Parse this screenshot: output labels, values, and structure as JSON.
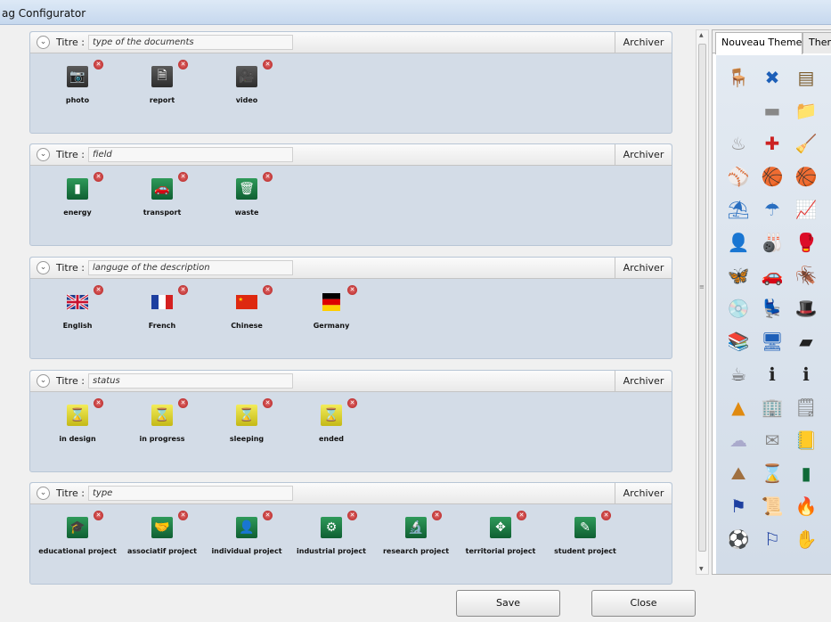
{
  "window": {
    "title": "ag Configurator"
  },
  "groups": [
    {
      "title_label": "Titre :",
      "title_value": "type of the documents",
      "archive_label": "Archiver",
      "items": [
        {
          "label": "photo",
          "icon": "camera-icon",
          "glyph": "📷",
          "style": "dark"
        },
        {
          "label": "report",
          "icon": "document-icon",
          "glyph": "🗎",
          "style": "dark"
        },
        {
          "label": "video",
          "icon": "video-camera-icon",
          "glyph": "🎥",
          "style": "dark"
        }
      ]
    },
    {
      "title_label": "Titre :",
      "title_value": "field",
      "archive_label": "Archiver",
      "items": [
        {
          "label": "energy",
          "icon": "battery-icon",
          "glyph": "▮",
          "style": "green"
        },
        {
          "label": "transport",
          "icon": "car-icon",
          "glyph": "🚗",
          "style": "green"
        },
        {
          "label": "waste",
          "icon": "trash-icon",
          "glyph": "🗑",
          "style": "green"
        }
      ]
    },
    {
      "title_label": "Titre :",
      "title_value": "languge of the description",
      "archive_label": "Archiver",
      "items": [
        {
          "label": "English",
          "icon": "uk-flag-icon",
          "glyph": "",
          "style": "flag-uk"
        },
        {
          "label": "French",
          "icon": "french-flag-icon",
          "glyph": "",
          "style": "flag-fr"
        },
        {
          "label": "Chinese",
          "icon": "chinese-flag-icon",
          "glyph": "",
          "style": "flag-cn"
        },
        {
          "label": "Germany",
          "icon": "german-flag-icon",
          "glyph": "",
          "style": "flag-de"
        }
      ]
    },
    {
      "title_label": "Titre :",
      "title_value": "status",
      "archive_label": "Archiver",
      "items": [
        {
          "label": "in design",
          "icon": "hourglass-icon",
          "glyph": "⌛",
          "style": "yellow"
        },
        {
          "label": "in progress",
          "icon": "hourglass-icon",
          "glyph": "⌛",
          "style": "yellow"
        },
        {
          "label": "sleeping",
          "icon": "hourglass-icon",
          "glyph": "⌛",
          "style": "yellow"
        },
        {
          "label": "ended",
          "icon": "hourglass-icon",
          "glyph": "⌛",
          "style": "yellow"
        }
      ]
    },
    {
      "title_label": "Titre :",
      "title_value": "type",
      "archive_label": "Archiver",
      "items": [
        {
          "label": "educational project",
          "icon": "graduation-cap-icon",
          "glyph": "🎓",
          "style": "green"
        },
        {
          "label": "associatif project",
          "icon": "handshake-icon",
          "glyph": "🤝",
          "style": "green"
        },
        {
          "label": "individual project",
          "icon": "user-icon",
          "glyph": "👤",
          "style": "green"
        },
        {
          "label": "industrial project",
          "icon": "gears-icon",
          "glyph": "⚙",
          "style": "green"
        },
        {
          "label": "research project",
          "icon": "microscope-icon",
          "glyph": "🔬",
          "style": "green"
        },
        {
          "label": "territorial project",
          "icon": "compass-icon",
          "glyph": "✥",
          "style": "green"
        },
        {
          "label": "student project",
          "icon": "notepad-icon",
          "glyph": "✎",
          "style": "green"
        }
      ]
    }
  ],
  "delete_glyph": "✕",
  "theme_panel": {
    "tabs": [
      "Nouveau Theme",
      "Them"
    ],
    "icons": [
      {
        "name": "chair-icon",
        "glyph": "🪑",
        "color": "#d42020"
      },
      {
        "name": "cross-icon",
        "glyph": "✖",
        "color": "#1d5fb8"
      },
      {
        "name": "abacus-icon",
        "glyph": "▤",
        "color": "#7a5a2a"
      },
      {
        "name": "apple-icon",
        "glyph": "",
        "color": "#3a8fd6"
      },
      {
        "name": "harddrive-icon",
        "glyph": "▬",
        "color": "#888"
      },
      {
        "name": "folder-icon",
        "glyph": "📁",
        "color": "#5aa0d0"
      },
      {
        "name": "chef-hat-icon",
        "glyph": "♨",
        "color": "#999"
      },
      {
        "name": "first-aid-icon",
        "glyph": "✚",
        "color": "#c22"
      },
      {
        "name": "broom-icon",
        "glyph": "🧹",
        "color": "#c77a10"
      },
      {
        "name": "baseball-icon",
        "glyph": "⚾",
        "color": "#b33"
      },
      {
        "name": "basketball-icon",
        "glyph": "🏀",
        "color": "#e06a10"
      },
      {
        "name": "basket-icon",
        "glyph": "🏀",
        "color": "#c05010"
      },
      {
        "name": "beach-chair-icon",
        "glyph": "⛱",
        "color": "#2a6fc0"
      },
      {
        "name": "umbrella-icon",
        "glyph": "☂",
        "color": "#2a6fc0"
      },
      {
        "name": "monitor-graph-icon",
        "glyph": "📈",
        "color": "#333"
      },
      {
        "name": "person-icon",
        "glyph": "👤",
        "color": "#444"
      },
      {
        "name": "bowling-icon",
        "glyph": "🎳",
        "color": "#222"
      },
      {
        "name": "boxing-icon",
        "glyph": "🥊",
        "color": "#c22"
      },
      {
        "name": "butterfly-icon",
        "glyph": "🦋",
        "color": "#e0509a"
      },
      {
        "name": "car-icon",
        "glyph": "🚗",
        "color": "#c22"
      },
      {
        "name": "cockroach-icon",
        "glyph": "🪳",
        "color": "#6a3a10"
      },
      {
        "name": "cd-icon",
        "glyph": "💿",
        "color": "#888"
      },
      {
        "name": "office-chair-icon",
        "glyph": "💺",
        "color": "#e07a10"
      },
      {
        "name": "hat-icon",
        "glyph": "🎩",
        "color": "#222"
      },
      {
        "name": "books-icon",
        "glyph": "📚",
        "color": "#c77a10"
      },
      {
        "name": "computer-icon",
        "glyph": "🖥",
        "color": "#1d5fb8"
      },
      {
        "name": "tv-icon",
        "glyph": "▰",
        "color": "#222"
      },
      {
        "name": "coffee-icon",
        "glyph": "☕",
        "color": "#555"
      },
      {
        "name": "info-icon",
        "glyph": "ℹ",
        "color": "#222"
      },
      {
        "name": "info-icon",
        "glyph": "ℹ",
        "color": "#222"
      },
      {
        "name": "cones-icon",
        "glyph": "▲",
        "color": "#e08a10"
      },
      {
        "name": "building-icon",
        "glyph": "🏢",
        "color": "#555"
      },
      {
        "name": "notes-icon",
        "glyph": "🗒",
        "color": "#777"
      },
      {
        "name": "cloud-icon",
        "glyph": "☁",
        "color": "#aac"
      },
      {
        "name": "letter-icon",
        "glyph": "✉",
        "color": "#888"
      },
      {
        "name": "binder-icon",
        "glyph": "📒",
        "color": "#c9a020"
      },
      {
        "name": "eiffel-tower-icon",
        "glyph": "⛰",
        "color": "#a07040"
      },
      {
        "name": "hourglass-icon",
        "glyph": "⌛",
        "color": "#b8ac10"
      },
      {
        "name": "battery-icon",
        "glyph": "▮",
        "color": "#0f6a38"
      },
      {
        "name": "eu-flag-icon",
        "glyph": "⚑",
        "color": "#1d3fa0"
      },
      {
        "name": "scroll-icon",
        "glyph": "📜",
        "color": "#c9a020"
      },
      {
        "name": "fire-icon",
        "glyph": "🔥",
        "color": "#e05010"
      },
      {
        "name": "user-ball-icon",
        "glyph": "⚽",
        "color": "#2a8a3a"
      },
      {
        "name": "french-flag-icon",
        "glyph": "⚐",
        "color": "#1d3fa0"
      },
      {
        "name": "hand-icon",
        "glyph": "✋",
        "color": "#e0a010"
      }
    ]
  },
  "buttons": {
    "save": "Save",
    "close": "Close"
  }
}
